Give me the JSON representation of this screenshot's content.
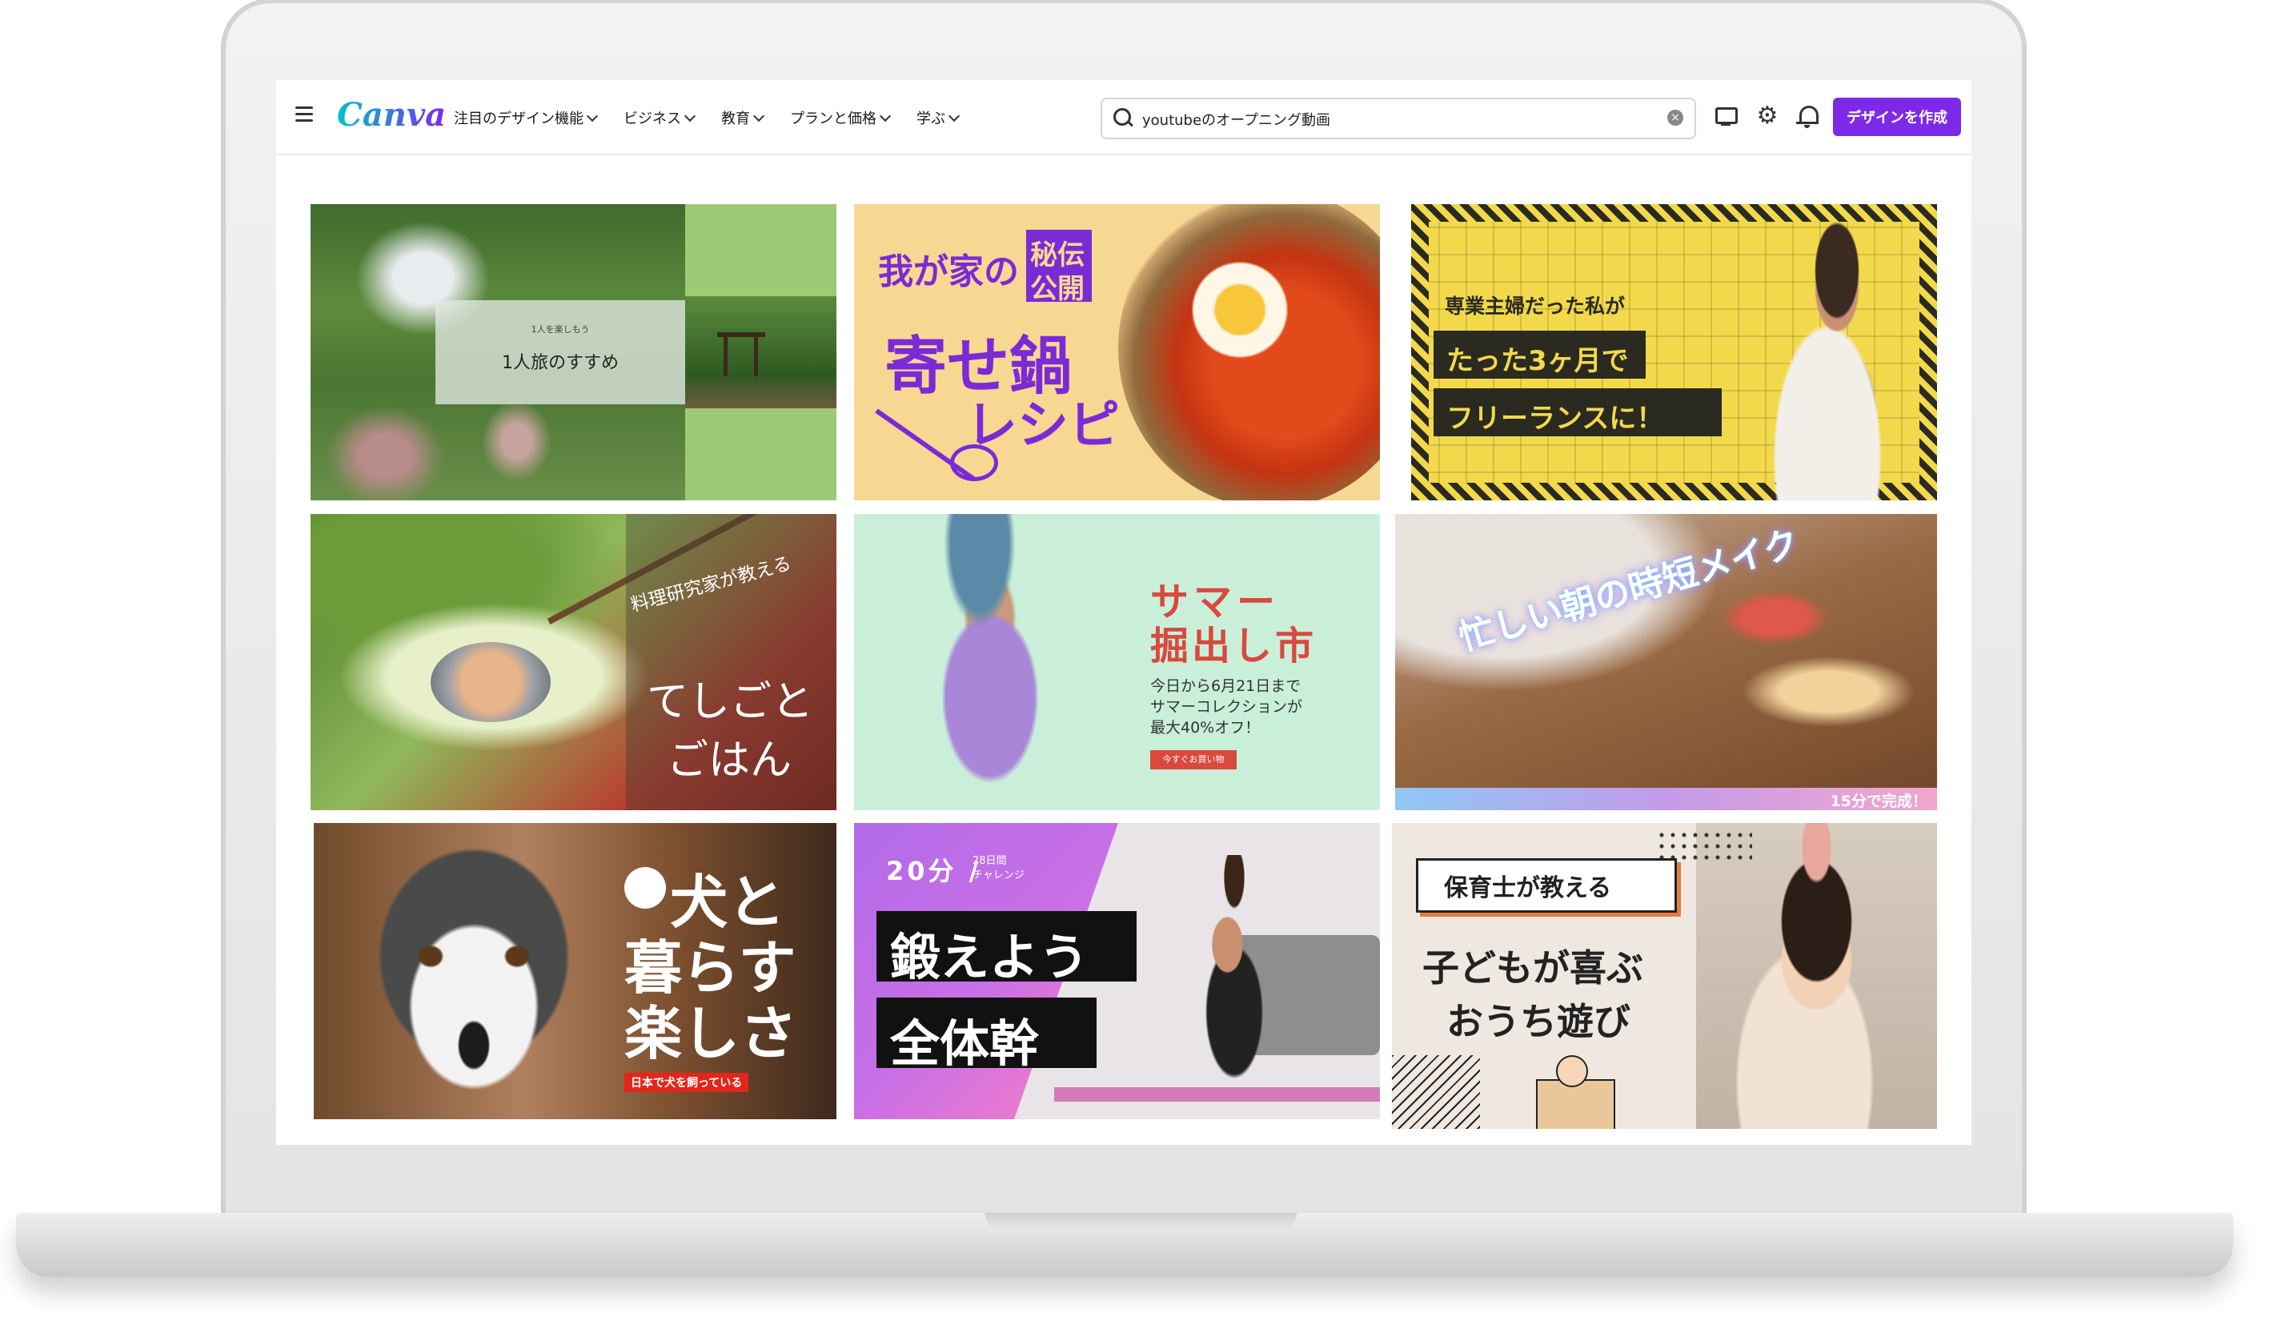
{
  "header": {
    "logo": "Canva",
    "nav": [
      {
        "label": "注目のデザイン機能"
      },
      {
        "label": "ビジネス"
      },
      {
        "label": "教育"
      },
      {
        "label": "プランと価格"
      },
      {
        "label": "学ぶ"
      }
    ],
    "search_value": "youtubeのオープニング動画",
    "create_label": "デザインを作成"
  },
  "templates": [
    {
      "sub": "1人を楽しもう",
      "title": "1人旅のすすめ"
    },
    {
      "line1": "我が家の",
      "badge1": "秘伝",
      "badge2": "公開",
      "line2": "寄せ鍋",
      "line3": "レシピ"
    },
    {
      "line1": "専業主婦だった私が",
      "line2": "たった3ヶ月で",
      "line3": "フリーランスに！"
    },
    {
      "sub": "料理研究家が教える",
      "line1": "てしごと",
      "line2": "ごはん"
    },
    {
      "line1": "サマー",
      "line2": "掘出し市",
      "desc1": "今日から6月21日まで",
      "desc2": "サマーコレクションが",
      "desc3": "最大40%オフ！",
      "button": "今すぐお買い物"
    },
    {
      "title": "忙しい朝の時短メイク",
      "tag": "15分で完成！"
    },
    {
      "line1": "犬と",
      "line2": "暮らす",
      "line3": "楽しさ",
      "tag": "日本で犬を飼っている"
    },
    {
      "minutes": "20分 /",
      "sub1": "28日間",
      "sub2": "チャレンジ",
      "line1": "鍛えよう",
      "line2": "全体幹"
    },
    {
      "tag": "保育士が教える",
      "line1": "子どもが喜ぶ",
      "line2": "おうち遊び"
    }
  ]
}
